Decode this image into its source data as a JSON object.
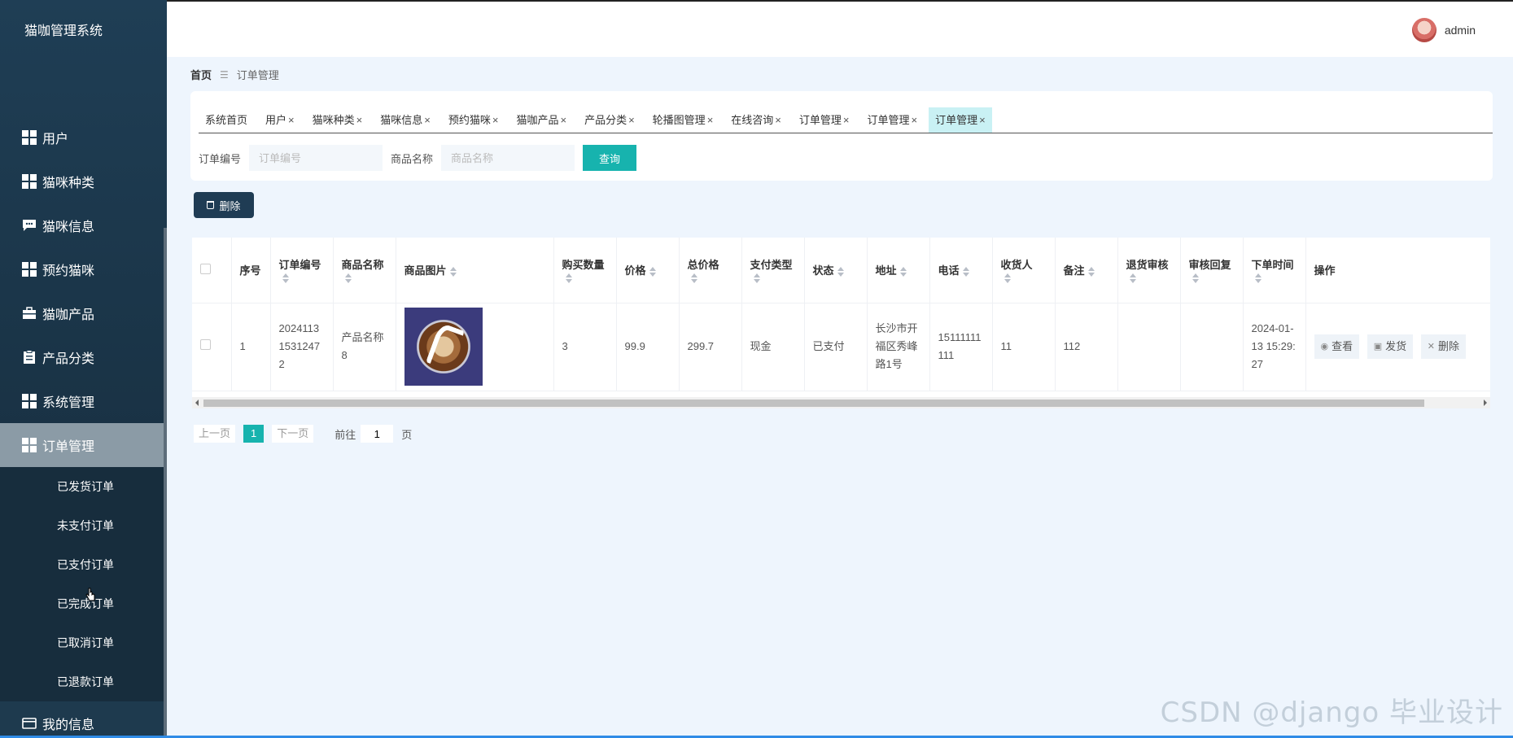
{
  "app": {
    "title": "猫咖管理系统"
  },
  "header": {
    "username": "admin"
  },
  "sidebar": {
    "items": [
      {
        "label": "用户",
        "icon": "grid-icon"
      },
      {
        "label": "猫咪种类",
        "icon": "grid-icon"
      },
      {
        "label": "猫咪信息",
        "icon": "chat-icon"
      },
      {
        "label": "预约猫咪",
        "icon": "grid-icon"
      },
      {
        "label": "猫咖产品",
        "icon": "briefcase-icon"
      },
      {
        "label": "产品分类",
        "icon": "clipboard-icon"
      },
      {
        "label": "系统管理",
        "icon": "grid-icon"
      },
      {
        "label": "订单管理",
        "icon": "grid-icon"
      }
    ],
    "submenu": [
      "已发货订单",
      "未支付订单",
      "已支付订单",
      "已完成订单",
      "已取消订单",
      "已退款订单"
    ],
    "my_info": "我的信息"
  },
  "breadcrumb": {
    "home": "首页",
    "current": "订单管理"
  },
  "tabs": [
    "系统首页",
    "用户",
    "猫咪种类",
    "猫咪信息",
    "预约猫咪",
    "猫咖产品",
    "产品分类",
    "轮播图管理",
    "在线咨询",
    "订单管理",
    "订单管理",
    "订单管理"
  ],
  "search": {
    "order_no_label": "订单编号",
    "order_no_placeholder": "订单编号",
    "product_label": "商品名称",
    "product_placeholder": "商品名称",
    "query_button": "查询"
  },
  "toolbar": {
    "delete_button": "删除"
  },
  "table": {
    "columns": [
      "序号",
      "订单编号",
      "商品名称",
      "商品图片",
      "购买数量",
      "价格",
      "总价格",
      "支付类型",
      "状态",
      "地址",
      "电话",
      "收货人",
      "备注",
      "退货审核",
      "审核回复",
      "下单时间",
      "操作"
    ],
    "rows": [
      {
        "index": "1",
        "order_no": "20241131531247 2",
        "product_name": "产品名称8",
        "quantity": "3",
        "price": "99.9",
        "total": "299.7",
        "pay_type": "现金",
        "status": "已支付",
        "address": "长沙市开福区秀峰路1号",
        "phone": "15111111111",
        "receiver": "11",
        "remark": "112",
        "return_review": "",
        "review_reply": "",
        "order_time": "2024-01-13 15:29:27",
        "ops": {
          "view": "查看",
          "ship": "发货",
          "delete": "删除"
        }
      }
    ]
  },
  "pagination": {
    "prev": "上一页",
    "current_page": "1",
    "next": "下一页",
    "goto_label": "前往",
    "goto_value": "1",
    "page_suffix": "页"
  },
  "watermark": "CSDN @django 毕业设计"
}
